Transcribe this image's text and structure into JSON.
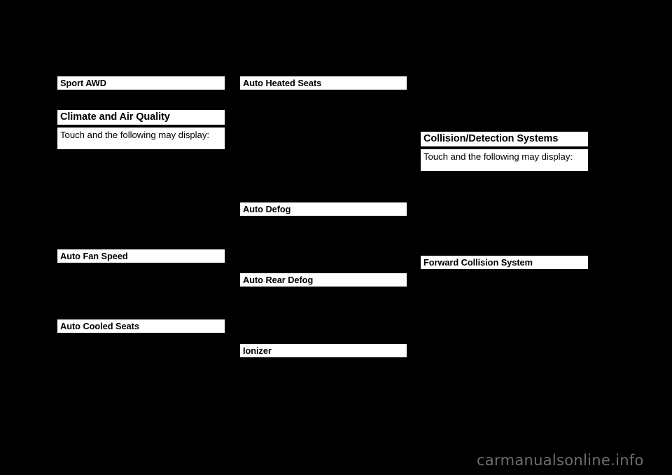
{
  "page": {
    "background_color": "#000000",
    "text_band_color": "#ffffff",
    "text_color": "#000000",
    "columns": 3
  },
  "left_column": {
    "blocks": [
      {
        "kind": "sub-head",
        "text": "Sport AWD"
      },
      {
        "kind": "section-head",
        "text": "Climate and Air Quality"
      },
      {
        "kind": "body-text",
        "text": "Touch and the following may display:"
      },
      {
        "kind": "sub-head",
        "text": "Auto Fan Speed"
      },
      {
        "kind": "sub-head",
        "text": "Auto Cooled Seats"
      }
    ]
  },
  "middle_column": {
    "blocks": [
      {
        "kind": "sub-head",
        "text": "Auto Heated Seats"
      },
      {
        "kind": "sub-head",
        "text": "Auto Defog"
      },
      {
        "kind": "sub-head",
        "text": "Auto Rear Defog"
      },
      {
        "kind": "sub-head",
        "text": "Ionizer"
      }
    ]
  },
  "right_column": {
    "blocks": [
      {
        "kind": "section-head",
        "text": "Collision/Detection Systems"
      },
      {
        "kind": "body-text",
        "text": "Touch and the following may display:"
      },
      {
        "kind": "sub-head",
        "text": "Forward Collision System"
      }
    ]
  },
  "watermark": {
    "text": "carmanualsonline.info",
    "color": "#6e6e6e"
  }
}
